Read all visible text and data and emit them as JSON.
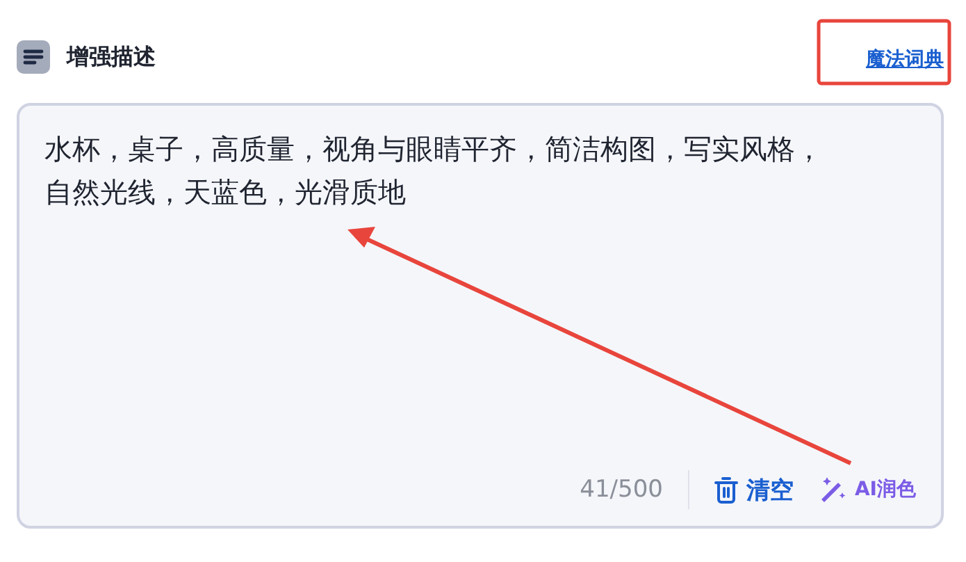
{
  "header": {
    "title": "增强描述",
    "link": "魔法词典"
  },
  "prompt": {
    "value": "水杯，桌子，高质量，视角与眼睛平齐，简洁构图，写实风格，自然光线，天蓝色，光滑质地",
    "count": "41/500"
  },
  "actions": [
    {
      "kind": "clear",
      "label": "清空"
    },
    {
      "kind": "polish",
      "label": "AI润色"
    }
  ]
}
